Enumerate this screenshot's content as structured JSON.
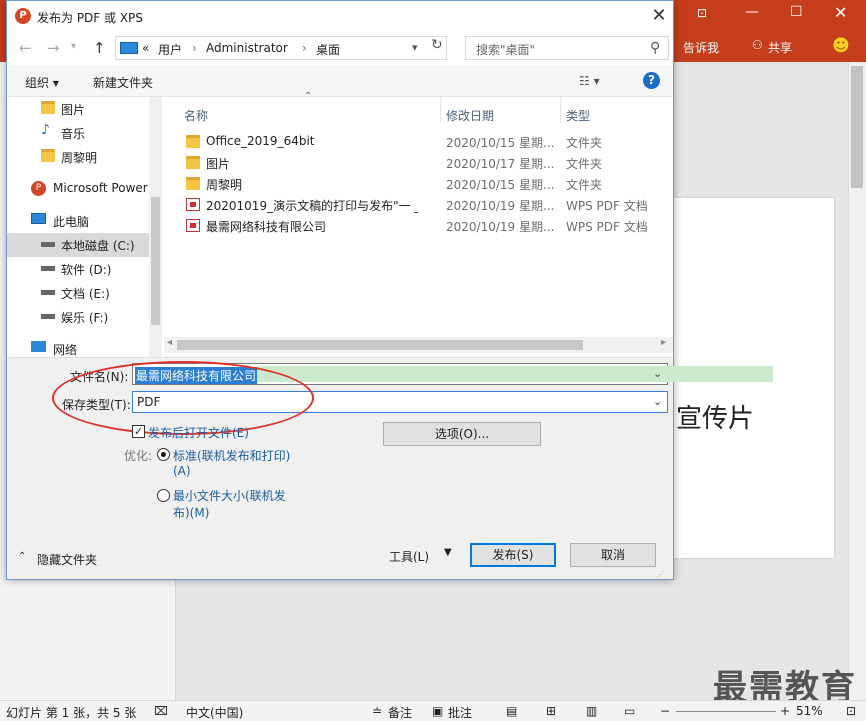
{
  "ppt": {
    "tell_me": "告诉我",
    "share": "共享",
    "slide_text": "宣传片",
    "watermark": "最需教育",
    "status": {
      "slide_info": "幻灯片 第 1 张，共 5 张",
      "language": "中文(中国)",
      "notes": "备注",
      "comments": "批注",
      "zoom": "51%"
    }
  },
  "dialog": {
    "title": "发布为 PDF 或 XPS",
    "address": {
      "sep": "«",
      "segments": [
        "用户",
        "Administrator",
        "桌面"
      ]
    },
    "search_placeholder": "搜索\"桌面\"",
    "toolbar": {
      "organize": "组织 ▾",
      "new_folder": "新建文件夹",
      "view": "☷ ▾",
      "help": "?"
    },
    "nav": [
      {
        "label": "图片",
        "icon": "folder-icon"
      },
      {
        "label": "音乐",
        "icon": "music-icon"
      },
      {
        "label": "周黎明",
        "icon": "folder-icon"
      },
      {
        "label": "Microsoft Power",
        "icon": "powerpoint-icon"
      },
      {
        "label": "此电脑",
        "icon": "computer-icon"
      },
      {
        "label": "本地磁盘 (C:)",
        "icon": "drive-icon"
      },
      {
        "label": "软件 (D:)",
        "icon": "drive-icon"
      },
      {
        "label": "文档 (E:)",
        "icon": "drive-icon"
      },
      {
        "label": "娱乐 (F:)",
        "icon": "drive-icon"
      },
      {
        "label": "网络",
        "icon": "network-icon"
      }
    ],
    "columns": {
      "name": "名称",
      "date": "修改日期",
      "type": "类型"
    },
    "files": [
      {
        "name": "Office_2019_64bit",
        "date": "2020/10/15 星期...",
        "type": "文件夹",
        "icon": "folder-icon"
      },
      {
        "name": "图片",
        "date": "2020/10/17 星期...",
        "type": "文件夹",
        "icon": "folder-icon"
      },
      {
        "name": "周黎明",
        "date": "2020/10/15 星期...",
        "type": "文件夹",
        "icon": "folder-icon"
      },
      {
        "name": "20201019_演示文稿的打印与发布\"一 _",
        "date": "2020/10/19 星期...",
        "type": "WPS PDF 文档",
        "icon": "pdf-icon"
      },
      {
        "name": "最需网络科技有限公司",
        "date": "2020/10/19 星期...",
        "type": "WPS PDF 文档",
        "icon": "pdf-icon"
      }
    ],
    "filename_label": "文件名(N):",
    "filename_value": "最需网络科技有限公司",
    "savetype_label": "保存类型(T):",
    "savetype_value": "PDF",
    "open_after": "发布后打开文件(E)",
    "options_button": "选项(O)...",
    "optimize_label": "优化:",
    "opt_standard_1": "标准(联机发布和打印)",
    "opt_standard_2": "(A)",
    "opt_min_1": "最小文件大小(联机发",
    "opt_min_2": "布)(M)",
    "hide_folders": "隐藏文件夹",
    "tools_button": "工具(L)",
    "publish_button": "发布(S)",
    "cancel_button": "取消"
  }
}
